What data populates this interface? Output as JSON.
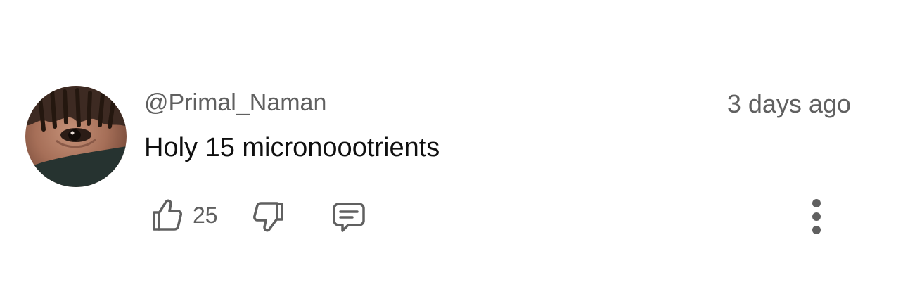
{
  "comment": {
    "author": "@Primal_Naman",
    "timestamp": "3 days ago",
    "text": "Holy 15 micronoootrients",
    "like_count": "25",
    "avatar": "avatar",
    "icons": {
      "like": "thumbs-up-icon",
      "dislike": "thumbs-down-icon",
      "reply": "reply-comment-icon",
      "more": "more-vertical-icon"
    },
    "colors": {
      "primary_text": "#0f0f0f",
      "secondary_text": "#606060",
      "background": "#ffffff"
    }
  }
}
